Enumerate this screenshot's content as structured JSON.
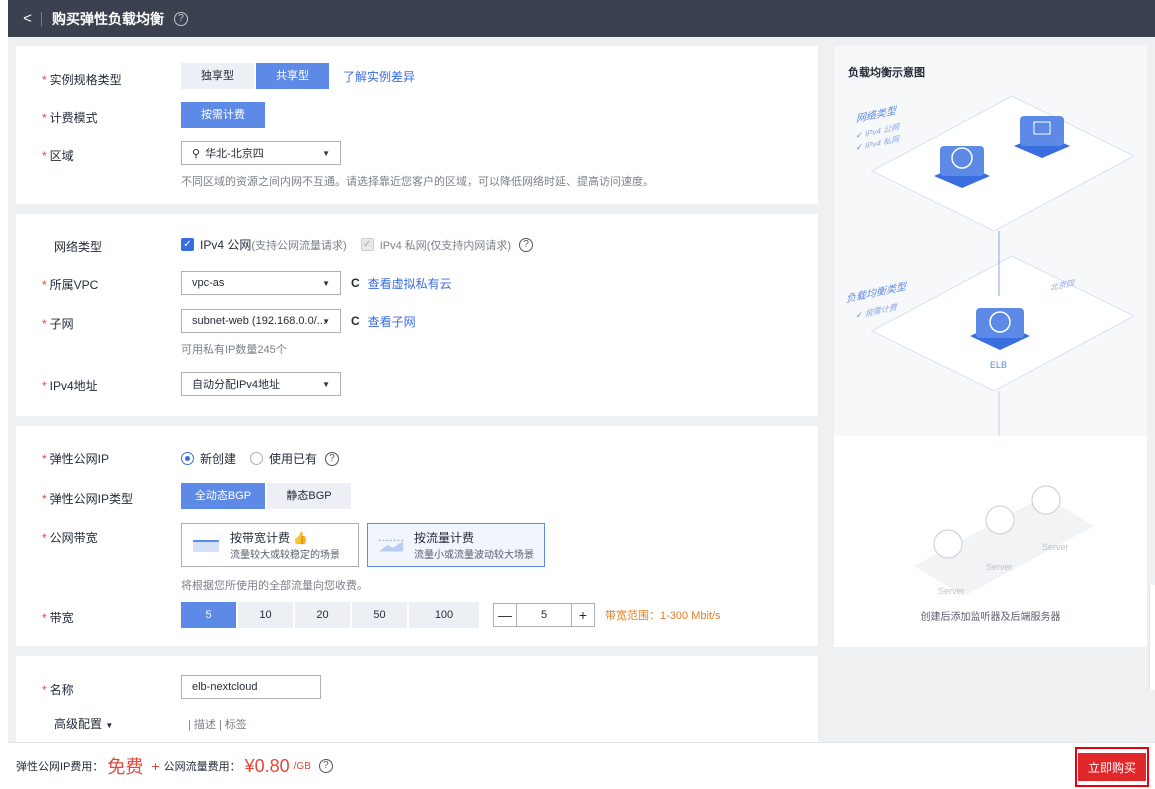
{
  "header": {
    "back": "<",
    "title": "购买弹性负载均衡",
    "help": "?"
  },
  "instance": {
    "label": "实例规格类型",
    "options": [
      "独享型",
      "共享型"
    ],
    "selected": "共享型",
    "link": "了解实例差异"
  },
  "billing": {
    "label": "计费模式",
    "value": "按需计费"
  },
  "region": {
    "label": "区域",
    "value": "华北-北京四",
    "hint": "不同区域的资源之间内网不互通。请选择靠近您客户的区域，可以降低网络时延、提高访问速度。"
  },
  "network": {
    "label": "网络类型",
    "ipv4_public": "IPv4 公网",
    "ipv4_public_note": "(支持公网流量请求)",
    "ipv4_private": "IPv4 私网(仅支持内网请求)",
    "help": "?"
  },
  "vpc": {
    "label": "所属VPC",
    "value": "vpc-as",
    "link": "查看虚拟私有云",
    "refresh": "C"
  },
  "subnet": {
    "label": "子网",
    "value": "subnet-web (192.168.0.0/...",
    "link": "查看子网",
    "refresh": "C",
    "hint": "可用私有IP数量245个"
  },
  "ipv4": {
    "label": "IPv4地址",
    "value": "自动分配IPv4地址"
  },
  "eip": {
    "label": "弹性公网IP",
    "opt_new": "新创建",
    "opt_existing": "使用已有",
    "help": "?"
  },
  "eip_type": {
    "label": "弹性公网IP类型",
    "options": [
      "全动态BGP",
      "静态BGP"
    ],
    "selected": "全动态BGP"
  },
  "bandwidth_mode": {
    "label": "公网带宽",
    "options": [
      {
        "title": "按带宽计费",
        "desc": "流量较大或较稳定的场景"
      },
      {
        "title": "按流量计费",
        "desc": "流量小或流量波动较大场景"
      }
    ],
    "hint": "将根据您所使用的全部流量向您收费。"
  },
  "bandwidth": {
    "label": "带宽",
    "options": [
      "5",
      "10",
      "20",
      "50",
      "100"
    ],
    "selected": "5",
    "minus": "—",
    "value": "5",
    "plus": "+",
    "range": "带宽范围：1-300 Mbit/s"
  },
  "name": {
    "label": "名称",
    "value": "elb-nextcloud"
  },
  "advanced": {
    "label": "高级配置",
    "items": "| 描述 | 标签"
  },
  "footer": {
    "eip_fee_label": "弹性公网IP费用：",
    "eip_fee": "免费",
    "plus": "+",
    "traffic_fee_label": "公网流量费用：",
    "traffic_fee": "¥0.80",
    "unit": "/GB",
    "help": "?",
    "buy": "立即购买"
  },
  "diagram": {
    "title": "负载均衡示意图",
    "net_type": "网络类型",
    "net_v4_public": "IPv4 公网",
    "net_v4_private": "IPv4 私网",
    "public": "公网",
    "private": "私网",
    "lb_type": "负载均衡类型",
    "lb_billing": "按需计费",
    "region": "北京四",
    "elb": "ELB",
    "server1": "Server",
    "server2": "Server",
    "server3": "Server",
    "caption": "创建后添加监听器及后端服务器"
  },
  "colors": {
    "primary": "#5c8ae6",
    "accent_red": "#e0282b",
    "header_bg": "#3c4150"
  }
}
